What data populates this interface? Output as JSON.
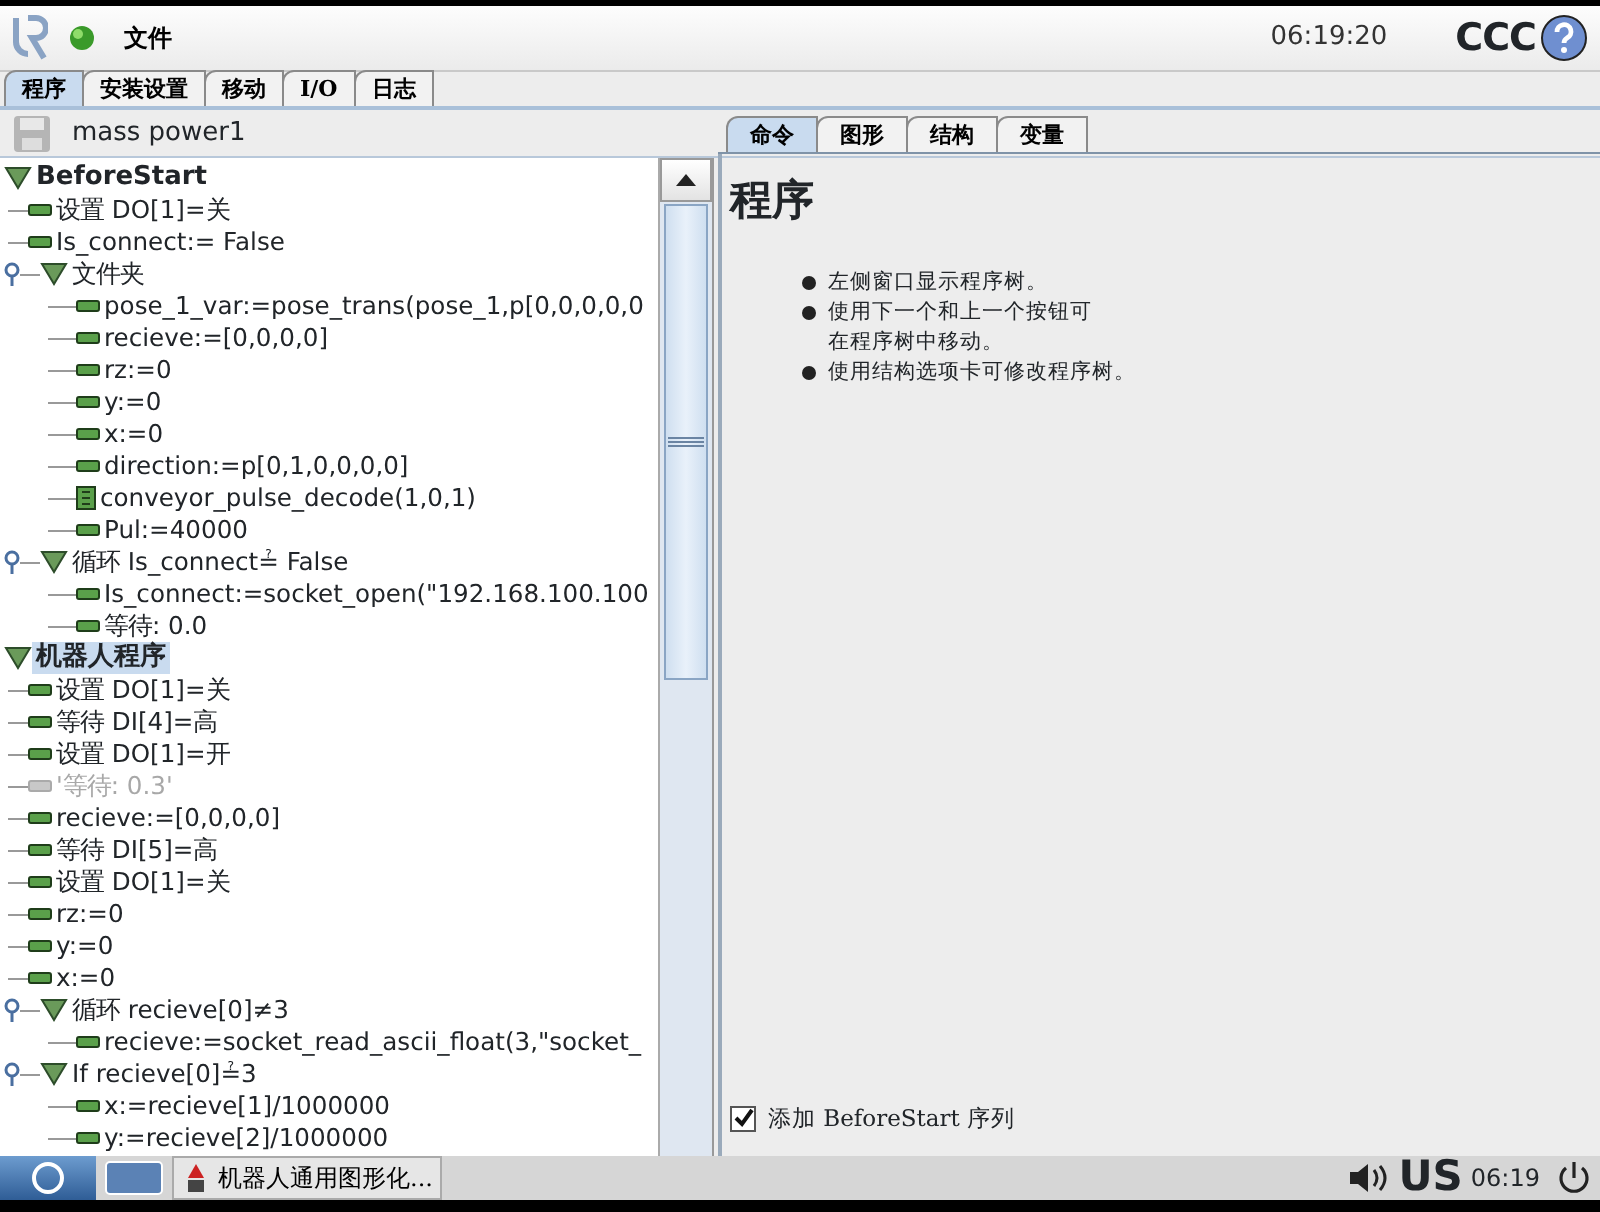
{
  "top_bar": {
    "menu": "文件",
    "time": "06:19:20",
    "robot_name": "CCC"
  },
  "tabs": [
    {
      "label": "程序",
      "selected": true
    },
    {
      "label": "安装设置",
      "selected": false
    },
    {
      "label": "移动",
      "selected": false
    },
    {
      "label": "I/O",
      "selected": false
    },
    {
      "label": "日志",
      "selected": false
    }
  ],
  "file": {
    "name": "mass power1",
    "save_disabled": true
  },
  "tree": [
    {
      "label": "BeforeStart",
      "kind": "section",
      "expanded": true,
      "selected": false,
      "children": [
        {
          "label": "设置 DO[1]=关",
          "kind": "command",
          "selected": false
        },
        {
          "label": "Is_connect:= False",
          "kind": "command",
          "selected": false
        },
        {
          "label": "文件夹",
          "kind": "folder",
          "expanded": true,
          "selected": false,
          "children": [
            {
              "label": "pose_1_var:=pose_trans(pose_1,p[0,0,0,0,0",
              "kind": "command",
              "selected": false
            },
            {
              "label": "recieve:=[0,0,0,0]",
              "kind": "command",
              "selected": false
            },
            {
              "label": "rz:=0",
              "kind": "command",
              "selected": false
            },
            {
              "label": "y:=0",
              "kind": "command",
              "selected": false
            },
            {
              "label": "x:=0",
              "kind": "command",
              "selected": false
            },
            {
              "label": "direction:=p[0,1,0,0,0,0]",
              "kind": "command",
              "selected": false
            },
            {
              "label": "conveyor_pulse_decode(1,0,1)",
              "kind": "script",
              "selected": false
            },
            {
              "label": "Pul:=40000",
              "kind": "command",
              "selected": false
            }
          ]
        },
        {
          "label": "循环 Is_connect≟ False",
          "kind": "folder",
          "expanded": true,
          "selected": false,
          "children": [
            {
              "label": "Is_connect:=socket_open(\"192.168.100.100",
              "kind": "command",
              "selected": false
            },
            {
              "label": "等待: 0.0",
              "kind": "command",
              "selected": false
            }
          ]
        }
      ]
    },
    {
      "label": "机器人程序",
      "kind": "section",
      "expanded": true,
      "selected": true,
      "children": [
        {
          "label": "设置 DO[1]=关",
          "kind": "command",
          "selected": false
        },
        {
          "label": "等待 DI[4]=高",
          "kind": "command",
          "selected": false
        },
        {
          "label": "设置 DO[1]=开",
          "kind": "command",
          "selected": false
        },
        {
          "label": "'等待: 0.3'",
          "kind": "disabled",
          "selected": false
        },
        {
          "label": "recieve:=[0,0,0,0]",
          "kind": "command",
          "selected": false
        },
        {
          "label": "等待 DI[5]=高",
          "kind": "command",
          "selected": false
        },
        {
          "label": "设置 DO[1]=关",
          "kind": "command",
          "selected": false
        },
        {
          "label": "rz:=0",
          "kind": "command",
          "selected": false
        },
        {
          "label": "y:=0",
          "kind": "command",
          "selected": false
        },
        {
          "label": "x:=0",
          "kind": "command",
          "selected": false
        },
        {
          "label": "循环 recieve[0]≠3",
          "kind": "folder",
          "expanded": true,
          "selected": false,
          "children": [
            {
              "label": "recieve:=socket_read_ascii_float(3,\"socket_",
              "kind": "command",
              "selected": false
            }
          ]
        },
        {
          "label": "If recieve[0]≟3",
          "kind": "folder",
          "expanded": true,
          "selected": false,
          "children": [
            {
              "label": "x:=recieve[1]/1000000",
              "kind": "command",
              "selected": false
            },
            {
              "label": "y:=recieve[2]/1000000",
              "kind": "command",
              "selected": false
            }
          ]
        }
      ]
    }
  ],
  "side_tabs": [
    {
      "label": "命令",
      "selected": true
    },
    {
      "label": "图形",
      "selected": false
    },
    {
      "label": "结构",
      "selected": false
    },
    {
      "label": "变量",
      "selected": false
    }
  ],
  "content": {
    "heading": "程序",
    "bullets": [
      "左侧窗口显示程序树。",
      "使用下一个和上一个按钮可在程序树中移动。",
      "使用结构选项卡可修改程序树。"
    ]
  },
  "before_start_option": {
    "label": "添加 BeforeStart 序列",
    "checked": true
  },
  "taskbar": {
    "app": "机器人通用图形化...",
    "layout": "US",
    "time": "06:19"
  }
}
